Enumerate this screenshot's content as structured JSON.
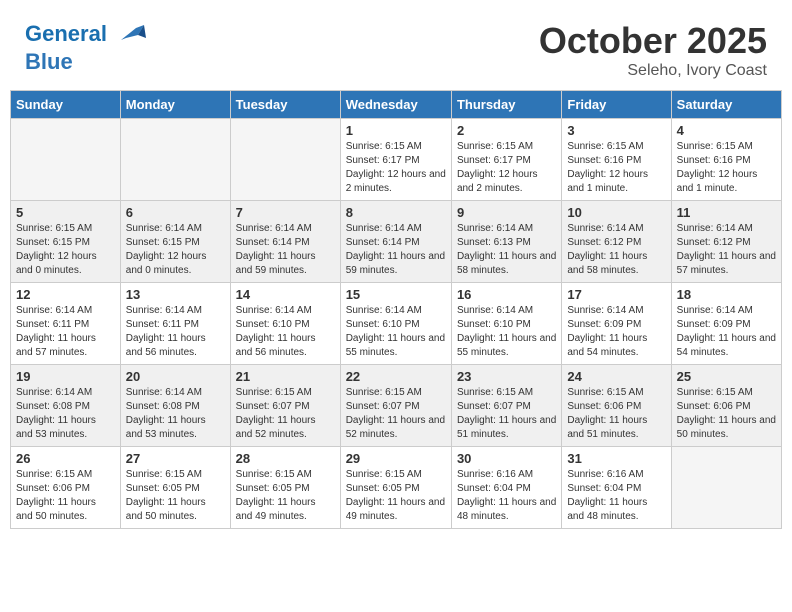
{
  "header": {
    "logo_line1": "General",
    "logo_line2": "Blue",
    "month": "October 2025",
    "location": "Seleho, Ivory Coast"
  },
  "days_of_week": [
    "Sunday",
    "Monday",
    "Tuesday",
    "Wednesday",
    "Thursday",
    "Friday",
    "Saturday"
  ],
  "weeks": [
    [
      {
        "day": "",
        "info": ""
      },
      {
        "day": "",
        "info": ""
      },
      {
        "day": "",
        "info": ""
      },
      {
        "day": "1",
        "info": "Sunrise: 6:15 AM\nSunset: 6:17 PM\nDaylight: 12 hours and 2 minutes."
      },
      {
        "day": "2",
        "info": "Sunrise: 6:15 AM\nSunset: 6:17 PM\nDaylight: 12 hours and 2 minutes."
      },
      {
        "day": "3",
        "info": "Sunrise: 6:15 AM\nSunset: 6:16 PM\nDaylight: 12 hours and 1 minute."
      },
      {
        "day": "4",
        "info": "Sunrise: 6:15 AM\nSunset: 6:16 PM\nDaylight: 12 hours and 1 minute."
      }
    ],
    [
      {
        "day": "5",
        "info": "Sunrise: 6:15 AM\nSunset: 6:15 PM\nDaylight: 12 hours and 0 minutes."
      },
      {
        "day": "6",
        "info": "Sunrise: 6:14 AM\nSunset: 6:15 PM\nDaylight: 12 hours and 0 minutes."
      },
      {
        "day": "7",
        "info": "Sunrise: 6:14 AM\nSunset: 6:14 PM\nDaylight: 11 hours and 59 minutes."
      },
      {
        "day": "8",
        "info": "Sunrise: 6:14 AM\nSunset: 6:14 PM\nDaylight: 11 hours and 59 minutes."
      },
      {
        "day": "9",
        "info": "Sunrise: 6:14 AM\nSunset: 6:13 PM\nDaylight: 11 hours and 58 minutes."
      },
      {
        "day": "10",
        "info": "Sunrise: 6:14 AM\nSunset: 6:12 PM\nDaylight: 11 hours and 58 minutes."
      },
      {
        "day": "11",
        "info": "Sunrise: 6:14 AM\nSunset: 6:12 PM\nDaylight: 11 hours and 57 minutes."
      }
    ],
    [
      {
        "day": "12",
        "info": "Sunrise: 6:14 AM\nSunset: 6:11 PM\nDaylight: 11 hours and 57 minutes."
      },
      {
        "day": "13",
        "info": "Sunrise: 6:14 AM\nSunset: 6:11 PM\nDaylight: 11 hours and 56 minutes."
      },
      {
        "day": "14",
        "info": "Sunrise: 6:14 AM\nSunset: 6:10 PM\nDaylight: 11 hours and 56 minutes."
      },
      {
        "day": "15",
        "info": "Sunrise: 6:14 AM\nSunset: 6:10 PM\nDaylight: 11 hours and 55 minutes."
      },
      {
        "day": "16",
        "info": "Sunrise: 6:14 AM\nSunset: 6:10 PM\nDaylight: 11 hours and 55 minutes."
      },
      {
        "day": "17",
        "info": "Sunrise: 6:14 AM\nSunset: 6:09 PM\nDaylight: 11 hours and 54 minutes."
      },
      {
        "day": "18",
        "info": "Sunrise: 6:14 AM\nSunset: 6:09 PM\nDaylight: 11 hours and 54 minutes."
      }
    ],
    [
      {
        "day": "19",
        "info": "Sunrise: 6:14 AM\nSunset: 6:08 PM\nDaylight: 11 hours and 53 minutes."
      },
      {
        "day": "20",
        "info": "Sunrise: 6:14 AM\nSunset: 6:08 PM\nDaylight: 11 hours and 53 minutes."
      },
      {
        "day": "21",
        "info": "Sunrise: 6:15 AM\nSunset: 6:07 PM\nDaylight: 11 hours and 52 minutes."
      },
      {
        "day": "22",
        "info": "Sunrise: 6:15 AM\nSunset: 6:07 PM\nDaylight: 11 hours and 52 minutes."
      },
      {
        "day": "23",
        "info": "Sunrise: 6:15 AM\nSunset: 6:07 PM\nDaylight: 11 hours and 51 minutes."
      },
      {
        "day": "24",
        "info": "Sunrise: 6:15 AM\nSunset: 6:06 PM\nDaylight: 11 hours and 51 minutes."
      },
      {
        "day": "25",
        "info": "Sunrise: 6:15 AM\nSunset: 6:06 PM\nDaylight: 11 hours and 50 minutes."
      }
    ],
    [
      {
        "day": "26",
        "info": "Sunrise: 6:15 AM\nSunset: 6:06 PM\nDaylight: 11 hours and 50 minutes."
      },
      {
        "day": "27",
        "info": "Sunrise: 6:15 AM\nSunset: 6:05 PM\nDaylight: 11 hours and 50 minutes."
      },
      {
        "day": "28",
        "info": "Sunrise: 6:15 AM\nSunset: 6:05 PM\nDaylight: 11 hours and 49 minutes."
      },
      {
        "day": "29",
        "info": "Sunrise: 6:15 AM\nSunset: 6:05 PM\nDaylight: 11 hours and 49 minutes."
      },
      {
        "day": "30",
        "info": "Sunrise: 6:16 AM\nSunset: 6:04 PM\nDaylight: 11 hours and 48 minutes."
      },
      {
        "day": "31",
        "info": "Sunrise: 6:16 AM\nSunset: 6:04 PM\nDaylight: 11 hours and 48 minutes."
      },
      {
        "day": "",
        "info": ""
      }
    ]
  ]
}
